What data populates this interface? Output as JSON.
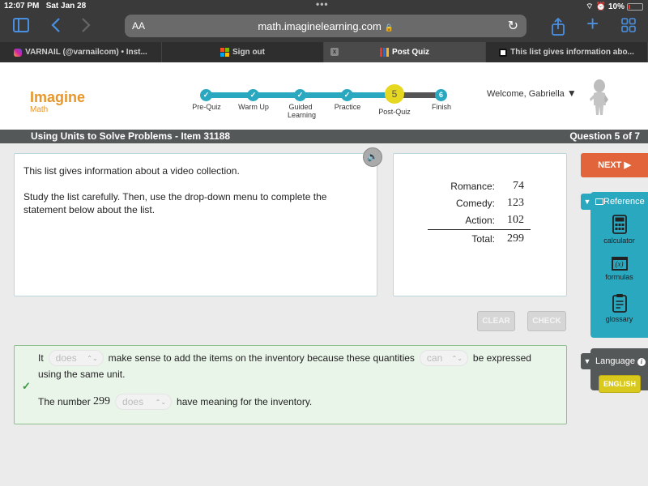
{
  "status_bar": {
    "time": "12:07 PM",
    "date": "Sat Jan 28",
    "battery": "10%",
    "icons": [
      "wifi-icon",
      "alarm-icon",
      "battery-icon"
    ]
  },
  "browser": {
    "reader_label": "AA",
    "url": "math.imaginelearning.com",
    "secure_icon": "lock-icon",
    "toolbar_icons": [
      "sidebar-icon",
      "back-icon",
      "forward-icon",
      "reload-icon",
      "share-icon",
      "new-tab-icon",
      "tabs-overview-icon"
    ],
    "tabs": [
      {
        "title": "VARNAIL (@varnailcom) • Inst...",
        "icon": "instagram-icon",
        "active": false
      },
      {
        "title": "Sign out",
        "icon": "microsoft-icon",
        "active": false
      },
      {
        "title": "Post Quiz",
        "icon": "imagine-learning-icon",
        "active": true,
        "close_label": "x"
      },
      {
        "title": "This list gives information abo...",
        "icon": "brainly-icon",
        "active": false
      }
    ]
  },
  "app": {
    "logo": {
      "title": "Imagine",
      "subtitle": "Math"
    },
    "progress": {
      "steps": [
        {
          "label": "Pre-Quiz",
          "state": "done"
        },
        {
          "label": "Warm Up",
          "state": "done"
        },
        {
          "label": "Guided Learning",
          "state": "done"
        },
        {
          "label": "Practice",
          "state": "done"
        },
        {
          "label": "Post-Quiz",
          "state": "current",
          "number": "5"
        },
        {
          "label": "Finish",
          "state": "upcoming",
          "number": "6"
        }
      ]
    },
    "welcome": "Welcome, Gabriella",
    "lesson_title": "Using Units to Solve Problems - Item 31188",
    "question_counter": "Question 5 of 7"
  },
  "prompt": {
    "paragraphs": [
      "This list gives information about a video collection.",
      "Study the list carefully. Then, use the drop-down menu to complete the statement below about the list."
    ]
  },
  "video_list": {
    "rows": [
      {
        "label": "Romance:",
        "value": "74"
      },
      {
        "label": "Comedy:",
        "value": "123"
      },
      {
        "label": "Action:",
        "value": "102"
      }
    ],
    "total": {
      "label": "Total:",
      "value": "299"
    }
  },
  "actions": {
    "clear": "CLEAR",
    "check": "CHECK",
    "next": "NEXT ▶"
  },
  "answer": {
    "sentence1": {
      "part1": "It",
      "select1": "does",
      "part2": "make sense to add the items on the inventory because these quantities",
      "select2": "can",
      "part3": "be expressed",
      "part4": "using the same unit."
    },
    "sentence2": {
      "part1": "The number",
      "number": "299",
      "select": "does",
      "part2": "have meaning for the inventory."
    },
    "status": "correct"
  },
  "reference": {
    "title": "Reference",
    "items": [
      {
        "label": "calculator",
        "icon": "calculator-icon"
      },
      {
        "label": "formulas",
        "icon": "formulas-icon",
        "glyph": "(x)"
      },
      {
        "label": "glossary",
        "icon": "glossary-icon"
      }
    ]
  },
  "language": {
    "title": "Language",
    "info": "i",
    "current": "ENGLISH"
  },
  "colors": {
    "brand_orange": "#e8962a",
    "teal": "#2aa8c0",
    "next_orange": "#e1643a",
    "current_step_yellow": "#e6d820",
    "correct_green": "#3a9a3a",
    "dark_bar": "#555859"
  }
}
